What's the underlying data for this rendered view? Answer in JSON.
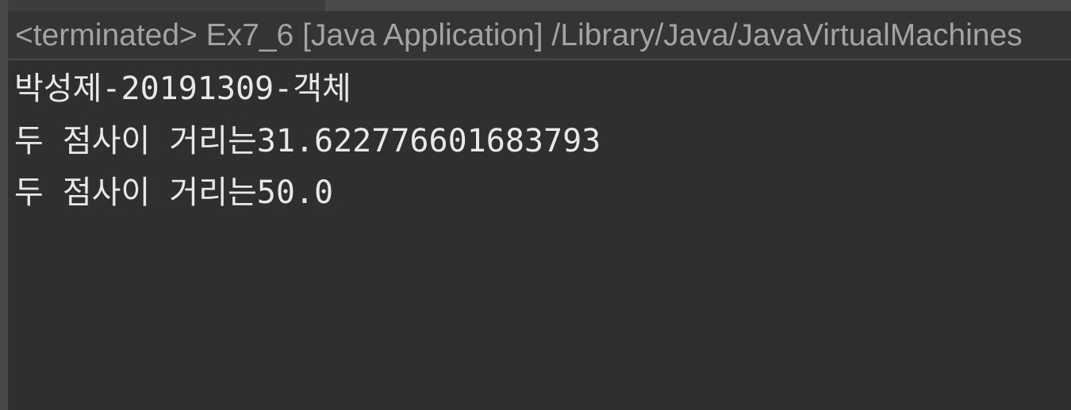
{
  "console": {
    "title": "<terminated> Ex7_6 [Java Application] /Library/Java/JavaVirtualMachines",
    "lines": [
      "박성제-20191309-객체",
      "두 점사이 거리는31.622776601683793",
      "두 점사이 거리는50.0"
    ]
  },
  "colors": {
    "background": "#2f2f2f",
    "title_text": "#a3a3a3",
    "output_text": "#e8e8e8"
  }
}
